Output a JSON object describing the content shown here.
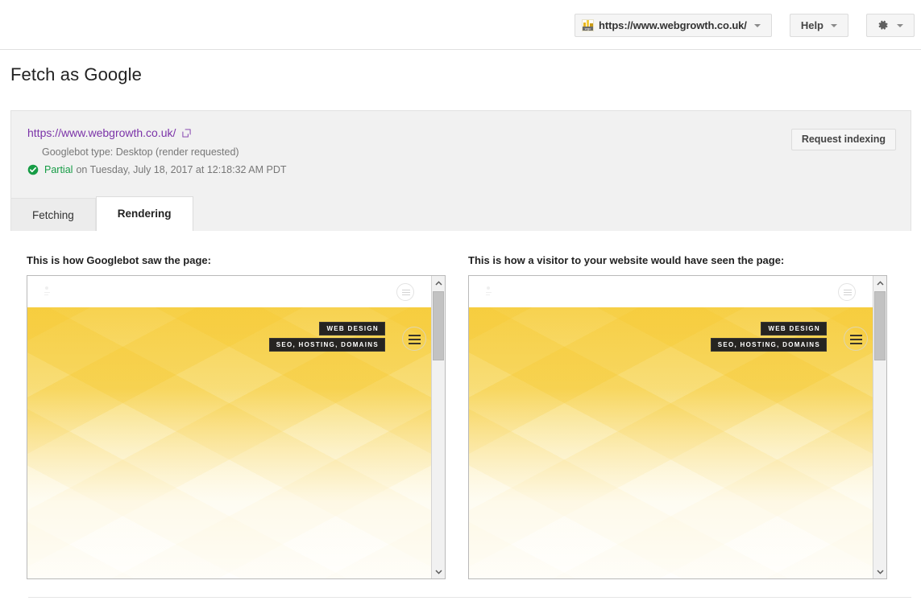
{
  "header": {
    "site_selector": {
      "favicon_name": "wgc-favicon",
      "favicon_text": "wgc",
      "url": "https://www.webgrowth.co.uk/",
      "caret_icon": "chevron-down-icon"
    },
    "help_button": {
      "label": "Help",
      "caret_icon": "chevron-down-icon"
    },
    "settings_button": {
      "icon": "gear-icon",
      "caret_icon": "chevron-down-icon"
    }
  },
  "page": {
    "title": "Fetch as Google"
  },
  "info": {
    "url": "https://www.webgrowth.co.uk/",
    "external_link_icon": "external-link-icon",
    "googlebot_type": "Googlebot type: Desktop (render requested)",
    "status_icon": "check-circle-icon",
    "status": "Partial",
    "status_detail": "on Tuesday, July 18, 2017 at 12:18:32 AM PDT",
    "request_indexing_label": "Request indexing",
    "status_color": "#169c45",
    "link_color": "#7b33a8"
  },
  "tabs": [
    {
      "label": "Fetching",
      "active": false
    },
    {
      "label": "Rendering",
      "active": true
    }
  ],
  "previews": [
    {
      "heading": "This is how Googlebot saw the page:",
      "site": {
        "logo_icon": "site-logo-icon",
        "top_menu_icon": "hamburger-menu-icon",
        "badges": [
          "WEB DESIGN",
          "SEO, HOSTING, DOMAINS"
        ],
        "hero_menu_icon": "hamburger-menu-icon",
        "badge_bg": "#262421",
        "hero_color": "#f7d456"
      },
      "scrollbar": {
        "up_icon": "chevron-up-icon",
        "down_icon": "chevron-down-icon"
      }
    },
    {
      "heading": "This is how a visitor to your website would have seen the page:",
      "site": {
        "logo_icon": "site-logo-icon",
        "top_menu_icon": "hamburger-menu-icon",
        "badges": [
          "WEB DESIGN",
          "SEO, HOSTING, DOMAINS"
        ],
        "hero_menu_icon": "hamburger-menu-icon",
        "badge_bg": "#262421",
        "hero_color": "#f7d456"
      },
      "scrollbar": {
        "up_icon": "chevron-up-icon",
        "down_icon": "chevron-down-icon"
      }
    }
  ]
}
